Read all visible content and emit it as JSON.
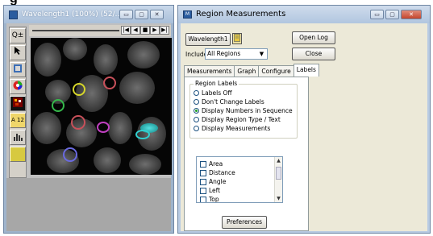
{
  "heading_fragment": "g",
  "image_window": {
    "title": "Wavelength1 (100%) (52/...",
    "buttons": {
      "minimize": "▭",
      "maximize": "▢",
      "close": "✕"
    },
    "nav_buttons": [
      "|◀",
      "◀",
      "■",
      "▶",
      "▶|"
    ],
    "tools": {
      "zoom": "Q±",
      "ruler": "A 12"
    },
    "roi_colors": {
      "yellow": "#d6d62a",
      "red": "#c8505a",
      "green": "#35b84b",
      "magenta": "#c040c0",
      "cyan": "#30d0d0",
      "blue": "#6a6ae0"
    }
  },
  "region_window": {
    "title": "Region Measurements",
    "title_icon": "M",
    "buttons": {
      "minimize": "▭",
      "maximize": "▢",
      "close": "✕"
    },
    "wavelength_button": "Wavelength1",
    "open_log_button": "Open Log",
    "close_button": "Close",
    "include_label": "Include",
    "include_select": {
      "value": "All Regions",
      "arrow": "▼"
    },
    "tabs": [
      "Measurements",
      "Graph",
      "Configure",
      "Labels"
    ],
    "active_tab": "Labels",
    "region_labels": {
      "group_label": "Region Labels",
      "options": [
        "Labels Off",
        "Don't Change Labels",
        "Display Numbers in Sequence",
        "Display Region Type / Text",
        "Display Measurements"
      ],
      "selected_index": 2
    },
    "measurement_list": [
      "Area",
      "Distance",
      "Angle",
      "Left",
      "Top"
    ],
    "scroll_up": "▲",
    "scroll_down": "▼",
    "preferences_button": "Preferences"
  }
}
